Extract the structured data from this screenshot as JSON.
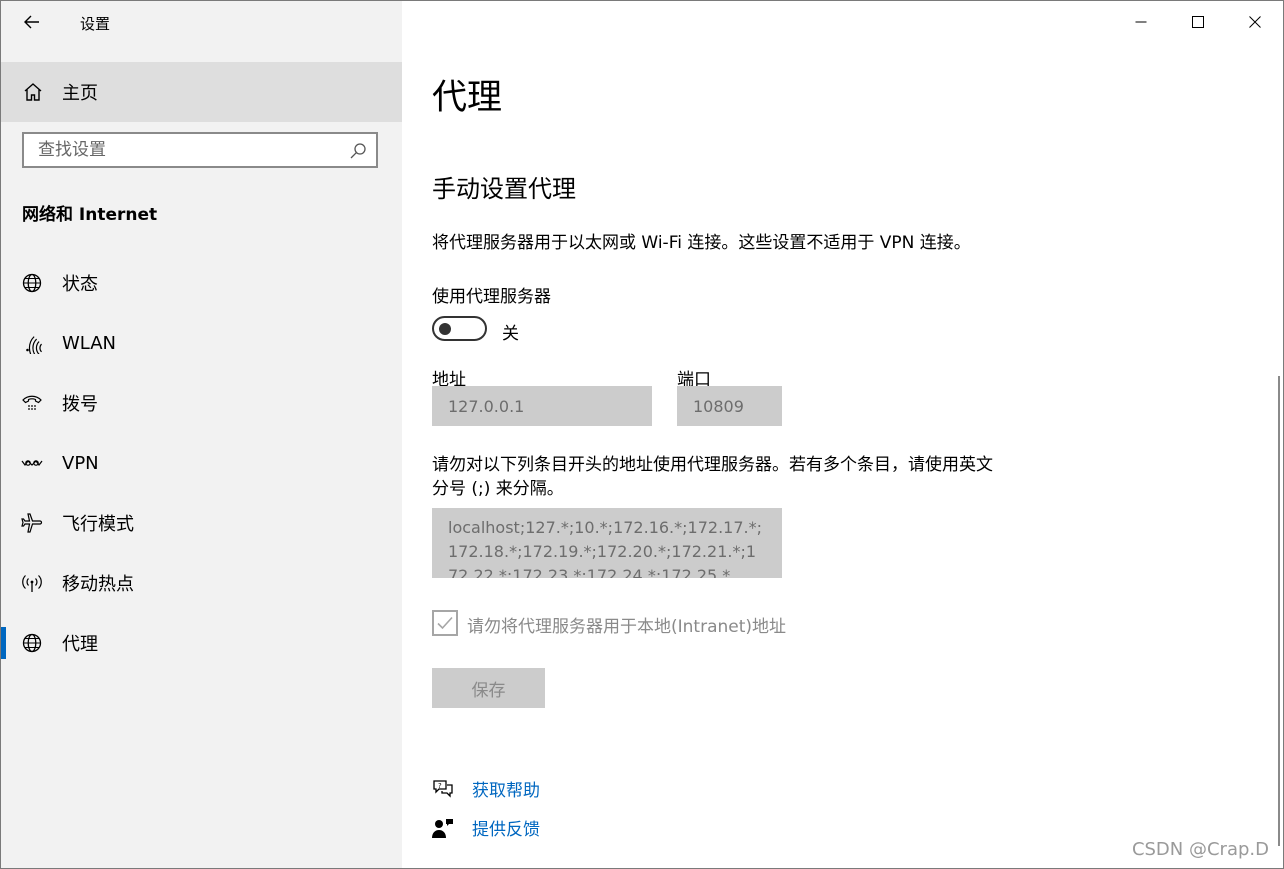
{
  "window": {
    "title": "设置"
  },
  "sidebar": {
    "home_label": "主页",
    "search_placeholder": "查找设置",
    "section_title": "网络和 Internet",
    "items": [
      {
        "label": "状态",
        "icon": "globe-status-icon"
      },
      {
        "label": "WLAN",
        "icon": "wifi-icon"
      },
      {
        "label": "拨号",
        "icon": "dialup-icon"
      },
      {
        "label": "VPN",
        "icon": "vpn-icon"
      },
      {
        "label": "飞行模式",
        "icon": "airplane-icon"
      },
      {
        "label": "移动热点",
        "icon": "hotspot-icon"
      },
      {
        "label": "代理",
        "icon": "globe-icon",
        "active": true
      }
    ]
  },
  "main": {
    "page_title": "代理",
    "section_title": "手动设置代理",
    "description": "将代理服务器用于以太网或 Wi-Fi 连接。这些设置不适用于 VPN 连接。",
    "use_proxy_label": "使用代理服务器",
    "toggle_state": "关",
    "address_label": "地址",
    "address_value": "127.0.0.1",
    "port_label": "端口",
    "port_value": "10809",
    "exclude_description": "请勿对以下列条目开头的地址使用代理服务器。若有多个条目，请使用英文分号 (;) 来分隔。",
    "exclude_value": "localhost;127.*;10.*;172.16.*;172.17.*;172.18.*;172.19.*;172.20.*;172.21.*;172.22.*;172.23.*;172.24.*;172.25.*",
    "local_checkbox_label": "请勿将代理服务器用于本地(Intranet)地址",
    "save_label": "保存",
    "help_label": "获取帮助",
    "feedback_label": "提供反馈"
  },
  "watermark": "CSDN @Crap.D",
  "colors": {
    "accent": "#0067c0",
    "sidebar_bg": "#f2f2f2",
    "disabled_field": "#cccccc"
  }
}
